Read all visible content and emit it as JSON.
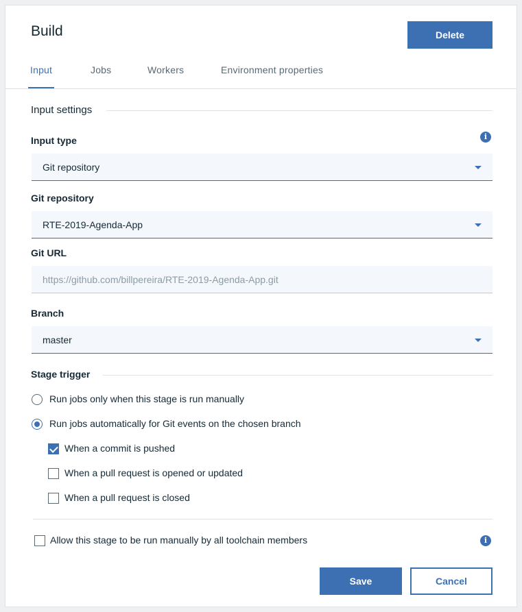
{
  "header": {
    "title": "Build",
    "delete_label": "Delete"
  },
  "tabs": [
    {
      "label": "Input",
      "active": true
    },
    {
      "label": "Jobs",
      "active": false
    },
    {
      "label": "Workers",
      "active": false
    },
    {
      "label": "Environment properties",
      "active": false
    }
  ],
  "input_settings": {
    "section_title": "Input settings",
    "input_type": {
      "label": "Input type",
      "value": "Git repository"
    },
    "git_repository": {
      "label": "Git repository",
      "value": "RTE-2019-Agenda-App"
    },
    "git_url": {
      "label": "Git URL",
      "value": "https://github.com/billpereira/RTE-2019-Agenda-App.git"
    },
    "branch": {
      "label": "Branch",
      "value": "master"
    }
  },
  "stage_trigger": {
    "section_title": "Stage trigger",
    "radios": [
      {
        "label": "Run jobs only when this stage is run manually",
        "checked": false
      },
      {
        "label": "Run jobs automatically for Git events on the chosen branch",
        "checked": true
      }
    ],
    "checkboxes": [
      {
        "label": "When a commit is pushed",
        "checked": true
      },
      {
        "label": "When a pull request is opened or updated",
        "checked": false
      },
      {
        "label": "When a pull request is closed",
        "checked": false
      }
    ]
  },
  "allow_manual": {
    "label": "Allow this stage to be run manually by all toolchain members",
    "checked": false
  },
  "footer": {
    "save_label": "Save",
    "cancel_label": "Cancel"
  },
  "icons": {
    "info": "info-icon",
    "caret": "chevron-down-icon"
  },
  "colors": {
    "accent": "#3d70b2",
    "field_bg": "#f4f7fb",
    "text": "#152935"
  }
}
